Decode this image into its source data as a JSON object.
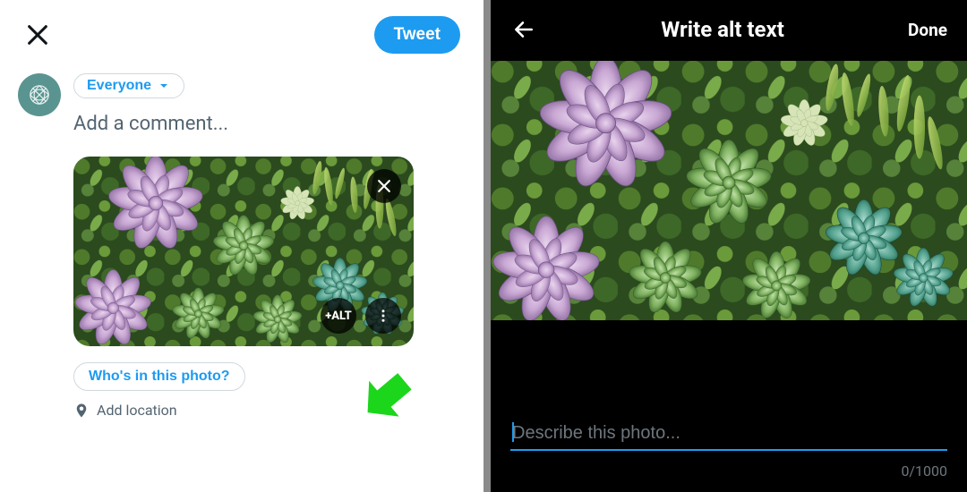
{
  "left": {
    "tweet_button": "Tweet",
    "audience_label": "Everyone",
    "compose_placeholder": "Add a comment...",
    "alt_button": "+ALT",
    "tag_people": "Who's in this photo?",
    "add_location": "Add location"
  },
  "right": {
    "title": "Write alt text",
    "done": "Done",
    "alt_placeholder": "Describe this photo...",
    "counter": "0/1000"
  }
}
